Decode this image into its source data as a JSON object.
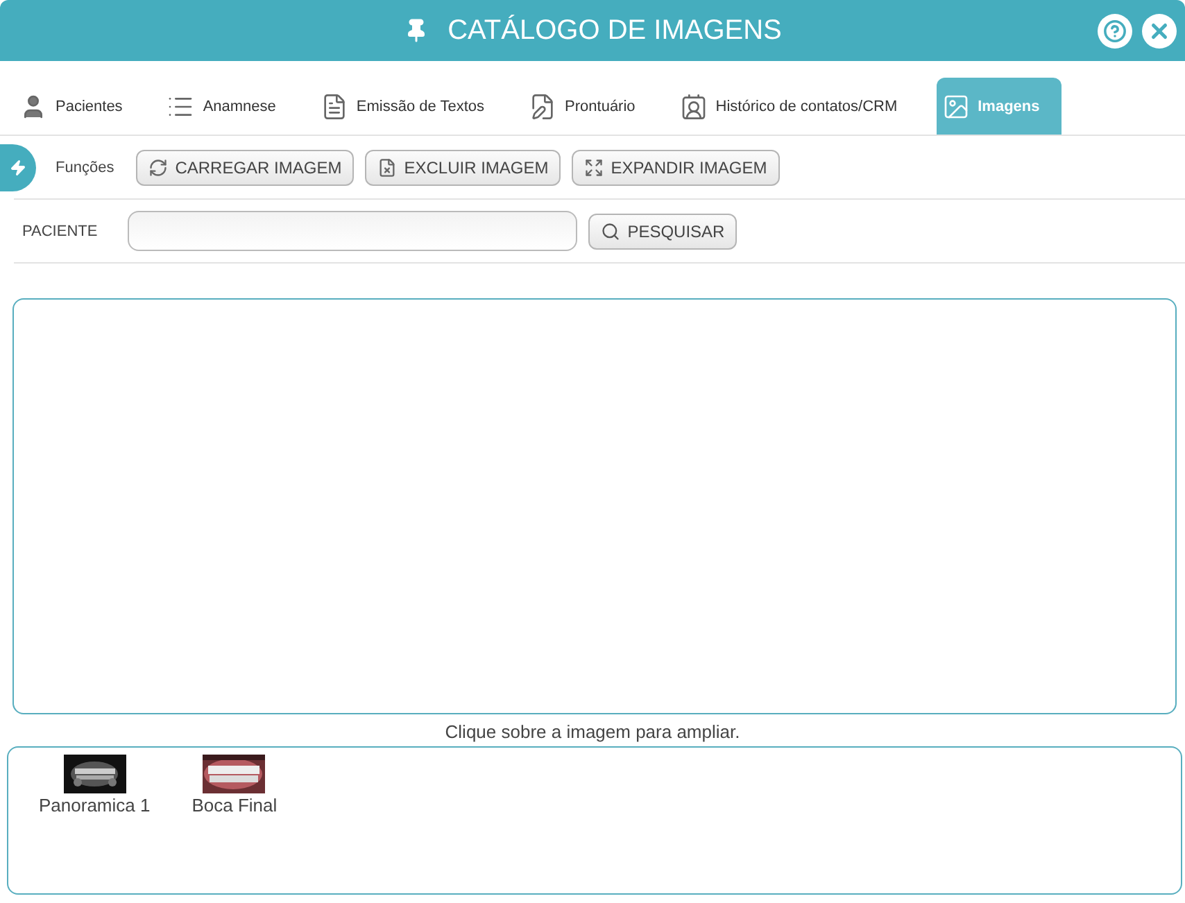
{
  "window": {
    "title": "CATÁLOGO DE IMAGENS"
  },
  "tabs": [
    {
      "label": "Pacientes",
      "selected": false
    },
    {
      "label": "Anamnese",
      "selected": false
    },
    {
      "label": "Emissão de Textos",
      "selected": false
    },
    {
      "label": "Prontuário",
      "selected": false
    },
    {
      "label": "Histórico de contatos/CRM",
      "selected": false
    },
    {
      "label": "Imagens",
      "selected": true
    }
  ],
  "functions": {
    "label": "Funções",
    "buttons": [
      {
        "label": "CARREGAR IMAGEM"
      },
      {
        "label": "EXCLUIR IMAGEM"
      },
      {
        "label": "EXPANDIR IMAGEM"
      }
    ]
  },
  "search": {
    "label": "PACIENTE",
    "button": "PESQUISAR"
  },
  "viewer": {
    "caption": "Clique sobre a imagem para ampliar."
  },
  "thumbnails": [
    {
      "kind": "picture",
      "caption": "Panoramica 1"
    },
    {
      "kind": "picture",
      "caption": "Boca Final"
    }
  ]
}
